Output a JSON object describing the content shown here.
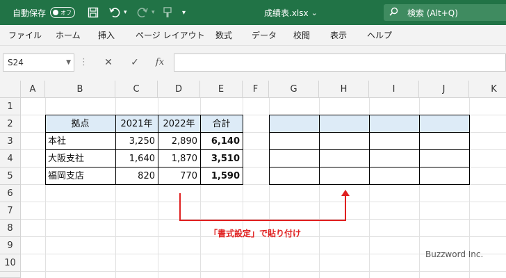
{
  "titlebar": {
    "autosave_label": "自動保存",
    "autosave_state": "オフ",
    "filename": "成績表.xlsx",
    "filename_chevron": "⌄",
    "search_placeholder": "検索 (Alt+Q)"
  },
  "menu": [
    "ファイル",
    "ホーム",
    "挿入",
    "ページ レイアウト",
    "数式",
    "データ",
    "校閲",
    "表示",
    "ヘルプ"
  ],
  "formula_bar": {
    "name_box": "S24",
    "cancel_icon": "✕",
    "enter_icon": "✓",
    "fx_icon": "fx",
    "value": ""
  },
  "columns": [
    "A",
    "B",
    "C",
    "D",
    "E",
    "F",
    "G",
    "H",
    "I",
    "J",
    "K"
  ],
  "rows": [
    "1",
    "2",
    "3",
    "4",
    "5",
    "6",
    "7",
    "8",
    "9",
    "10"
  ],
  "table": {
    "headers": [
      "拠点",
      "2021年",
      "2022年",
      "合計"
    ],
    "rows": [
      [
        "本社",
        "3,250",
        "2,890",
        "6,140"
      ],
      [
        "大阪支社",
        "1,640",
        "1,870",
        "3,510"
      ],
      [
        "福岡支店",
        "820",
        "770",
        "1,590"
      ]
    ]
  },
  "annotation": {
    "text": "「書式設定」で貼り付け",
    "color": "#e02020"
  },
  "watermark": "Buzzword Inc.",
  "colors": {
    "titlebar_bg": "#217346",
    "header_fill": "#ddebf7"
  }
}
